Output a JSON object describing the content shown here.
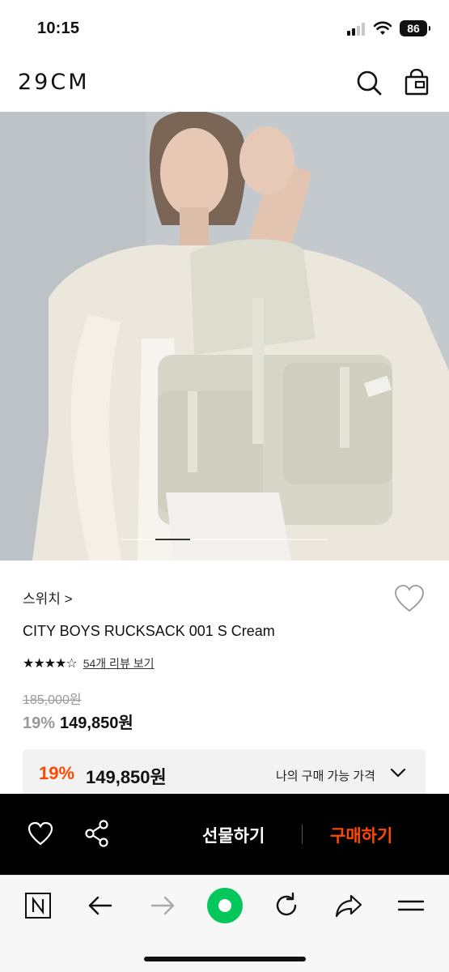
{
  "status_bar": {
    "time": "10:15",
    "battery": "86"
  },
  "header": {
    "logo": "29CM"
  },
  "hero": {
    "carousel_active_index": 1,
    "carousel_count": 6
  },
  "product": {
    "brand": "스위치 >",
    "name": "CITY BOYS RUCKSACK 001 S Cream",
    "stars": "★★★★☆",
    "rating_value": 4.5,
    "review_link": "54개 리뷰 보기",
    "original_price": "185,000원",
    "discount": "19%",
    "sale_price": "149,850원"
  },
  "my_price": {
    "discount": "19%",
    "price": "149,850원",
    "label": "나의 구매 가능 가격"
  },
  "action_bar": {
    "gift_label": "선물하기",
    "buy_label": "구매하기"
  },
  "colors": {
    "accent": "#ff4800",
    "action_bar_bg": "#000000",
    "naver_green": "#03c75a"
  }
}
